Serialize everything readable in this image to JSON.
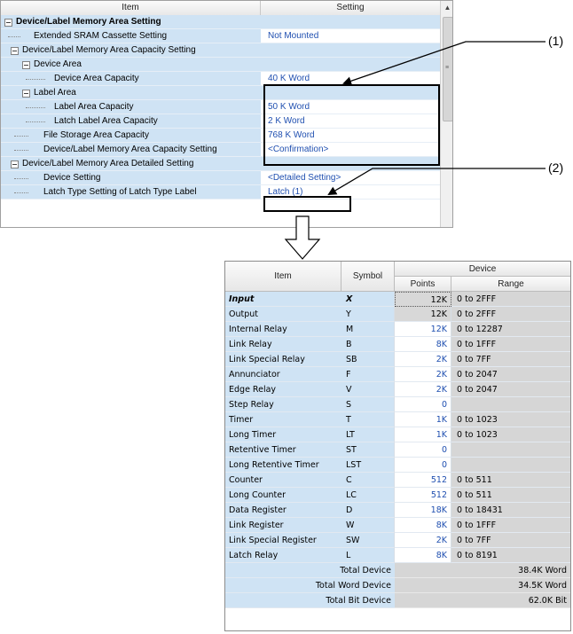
{
  "settings_grid": {
    "header": {
      "item": "Item",
      "setting": "Setting"
    },
    "rows": [
      {
        "label": "Device/Label Memory Area Setting",
        "value": ""
      },
      {
        "label": "Extended SRAM Cassette Setting",
        "value": "Not Mounted"
      },
      {
        "label": "Device/Label Memory Area Capacity Setting",
        "value": ""
      },
      {
        "label": "Device Area",
        "value": ""
      },
      {
        "label": "Device Area Capacity",
        "value": "40 K Word"
      },
      {
        "label": "Label Area",
        "value": ""
      },
      {
        "label": "Label Area Capacity",
        "value": "50 K Word"
      },
      {
        "label": "Latch Label Area Capacity",
        "value": "2 K Word"
      },
      {
        "label": "File Storage Area Capacity",
        "value": "768 K Word"
      },
      {
        "label": "Device/Label Memory Area Capacity Setting",
        "value": "<Confirmation>"
      },
      {
        "label": "Device/Label Memory Area Detailed Setting",
        "value": ""
      },
      {
        "label": "Device Setting",
        "value": "<Detailed Setting>"
      },
      {
        "label": "Latch Type Setting of Latch Type Label",
        "value": "Latch (1)"
      }
    ]
  },
  "callouts": {
    "one": "(1)",
    "two": "(2)"
  },
  "device_table": {
    "header": {
      "item": "Item",
      "symbol": "Symbol",
      "device": "Device",
      "points": "Points",
      "range": "Range"
    },
    "rows": [
      {
        "item": "Input",
        "symbol": "X",
        "points": "12K",
        "range": "0 to 2FFF"
      },
      {
        "item": "Output",
        "symbol": "Y",
        "points": "12K",
        "range": "0 to 2FFF"
      },
      {
        "item": "Internal Relay",
        "symbol": "M",
        "points": "12K",
        "range": "0 to 12287"
      },
      {
        "item": "Link Relay",
        "symbol": "B",
        "points": "8K",
        "range": "0 to 1FFF"
      },
      {
        "item": "Link Special Relay",
        "symbol": "SB",
        "points": "2K",
        "range": "0 to 7FF"
      },
      {
        "item": "Annunciator",
        "symbol": "F",
        "points": "2K",
        "range": "0 to 2047"
      },
      {
        "item": "Edge Relay",
        "symbol": "V",
        "points": "2K",
        "range": "0 to 2047"
      },
      {
        "item": "Step Relay",
        "symbol": "S",
        "points": "0",
        "range": ""
      },
      {
        "item": "Timer",
        "symbol": "T",
        "points": "1K",
        "range": "0 to 1023"
      },
      {
        "item": "Long Timer",
        "symbol": "LT",
        "points": "1K",
        "range": "0 to 1023"
      },
      {
        "item": "Retentive Timer",
        "symbol": "ST",
        "points": "0",
        "range": ""
      },
      {
        "item": "Long Retentive Timer",
        "symbol": "LST",
        "points": "0",
        "range": ""
      },
      {
        "item": "Counter",
        "symbol": "C",
        "points": "512",
        "range": "0 to 511"
      },
      {
        "item": "Long Counter",
        "symbol": "LC",
        "points": "512",
        "range": "0 to 511"
      },
      {
        "item": "Data Register",
        "symbol": "D",
        "points": "18K",
        "range": "0 to 18431"
      },
      {
        "item": "Link Register",
        "symbol": "W",
        "points": "8K",
        "range": "0 to 1FFF"
      },
      {
        "item": "Link Special Register",
        "symbol": "SW",
        "points": "2K",
        "range": "0 to 7FF"
      },
      {
        "item": "Latch Relay",
        "symbol": "L",
        "points": "8K",
        "range": "0 to 8191"
      }
    ],
    "totals": [
      {
        "label": "Total Device",
        "value": "38.4K Word"
      },
      {
        "label": "Total Word Device",
        "value": "34.5K Word"
      },
      {
        "label": "Total Bit Device",
        "value": "62.0K Bit"
      }
    ]
  }
}
